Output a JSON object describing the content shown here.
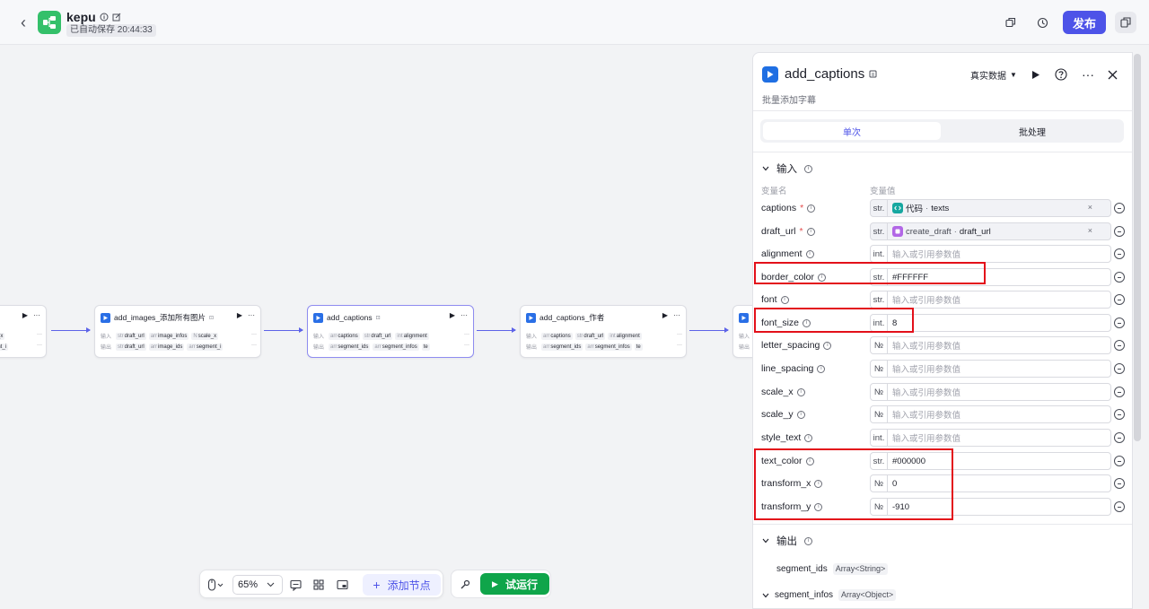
{
  "topbar": {
    "title": "kepu",
    "autosave": "已自动保存 20:44:33",
    "publish_label": "发布"
  },
  "canvas": {
    "nodes": [
      {
        "title": "add_images_添加所有图片",
        "in_label": "输入",
        "out_label": "输出",
        "inputs": [
          "draft_url",
          "image_infos",
          "scale_x"
        ],
        "outputs": [
          "draft_url",
          "image_ids",
          "segment_i"
        ]
      },
      {
        "title": "add_captions",
        "in_label": "输入",
        "out_label": "输出",
        "inputs": [
          "captions",
          "draft_url",
          "alignment"
        ],
        "outputs": [
          "segment_ids",
          "segment_infos",
          "te"
        ]
      },
      {
        "title": "add_captions_作者",
        "in_label": "输入",
        "out_label": "输出",
        "inputs": [
          "captions",
          "draft_url",
          "alignment"
        ],
        "outputs": [
          "segment_ids",
          "segment_infos",
          "te"
        ]
      },
      {
        "title": "",
        "in_label": "输入",
        "out_label": "输出",
        "inputs": [
          "ale_x"
        ],
        "outputs": [
          "ment_i"
        ]
      },
      {
        "title": "",
        "in_label": "输入",
        "out_label": "输出",
        "inputs": [],
        "outputs": []
      }
    ],
    "toolbar": {
      "zoom": "65%",
      "add_node_label": "添加节点",
      "run_label": "试运行"
    }
  },
  "panel": {
    "title": "add_captions",
    "subtitle": "批量添加字幕",
    "data_mode": "真实数据",
    "tabs": [
      "单次",
      "批处理"
    ],
    "input_section": "输入",
    "col_name": "变量名",
    "col_value": "变量值",
    "output_section": "输出",
    "placeholder": "输入或引用参数值",
    "inputs": [
      {
        "name": "captions",
        "required": true,
        "type": "str.",
        "ref": true,
        "ref_node": "代码",
        "ref_var": "texts",
        "ref_color": "#16a7a0",
        "value": ""
      },
      {
        "name": "draft_url",
        "required": true,
        "type": "str.",
        "ref": true,
        "ref_node": "create_draft",
        "ref_var": "draft_url",
        "ref_color": "#b267e6",
        "value": ""
      },
      {
        "name": "alignment",
        "required": false,
        "type": "int.",
        "ref": false,
        "value": ""
      },
      {
        "name": "border_color",
        "required": false,
        "type": "str.",
        "ref": false,
        "value": "#FFFFFF"
      },
      {
        "name": "font",
        "required": false,
        "type": "str.",
        "ref": false,
        "value": ""
      },
      {
        "name": "font_size",
        "required": false,
        "type": "int.",
        "ref": false,
        "value": "8"
      },
      {
        "name": "letter_spacing",
        "required": false,
        "type": "№",
        "ref": false,
        "value": ""
      },
      {
        "name": "line_spacing",
        "required": false,
        "type": "№",
        "ref": false,
        "value": ""
      },
      {
        "name": "scale_x",
        "required": false,
        "type": "№",
        "ref": false,
        "value": ""
      },
      {
        "name": "scale_y",
        "required": false,
        "type": "№",
        "ref": false,
        "value": ""
      },
      {
        "name": "style_text",
        "required": false,
        "type": "int.",
        "ref": false,
        "value": ""
      },
      {
        "name": "text_color",
        "required": false,
        "type": "str.",
        "ref": false,
        "value": "#000000"
      },
      {
        "name": "transform_x",
        "required": false,
        "type": "№",
        "ref": false,
        "value": "0"
      },
      {
        "name": "transform_y",
        "required": false,
        "type": "№",
        "ref": false,
        "value": "-910"
      }
    ],
    "outputs": [
      {
        "name": "segment_ids",
        "type": "Array<String>"
      },
      {
        "name": "segment_infos",
        "type": "Array<Object>"
      }
    ]
  },
  "colors": {
    "accent": "#4d53e8",
    "run_green": "#0fa54a",
    "highlight_red": "#e3101a",
    "logo_green": "#34c06a"
  }
}
